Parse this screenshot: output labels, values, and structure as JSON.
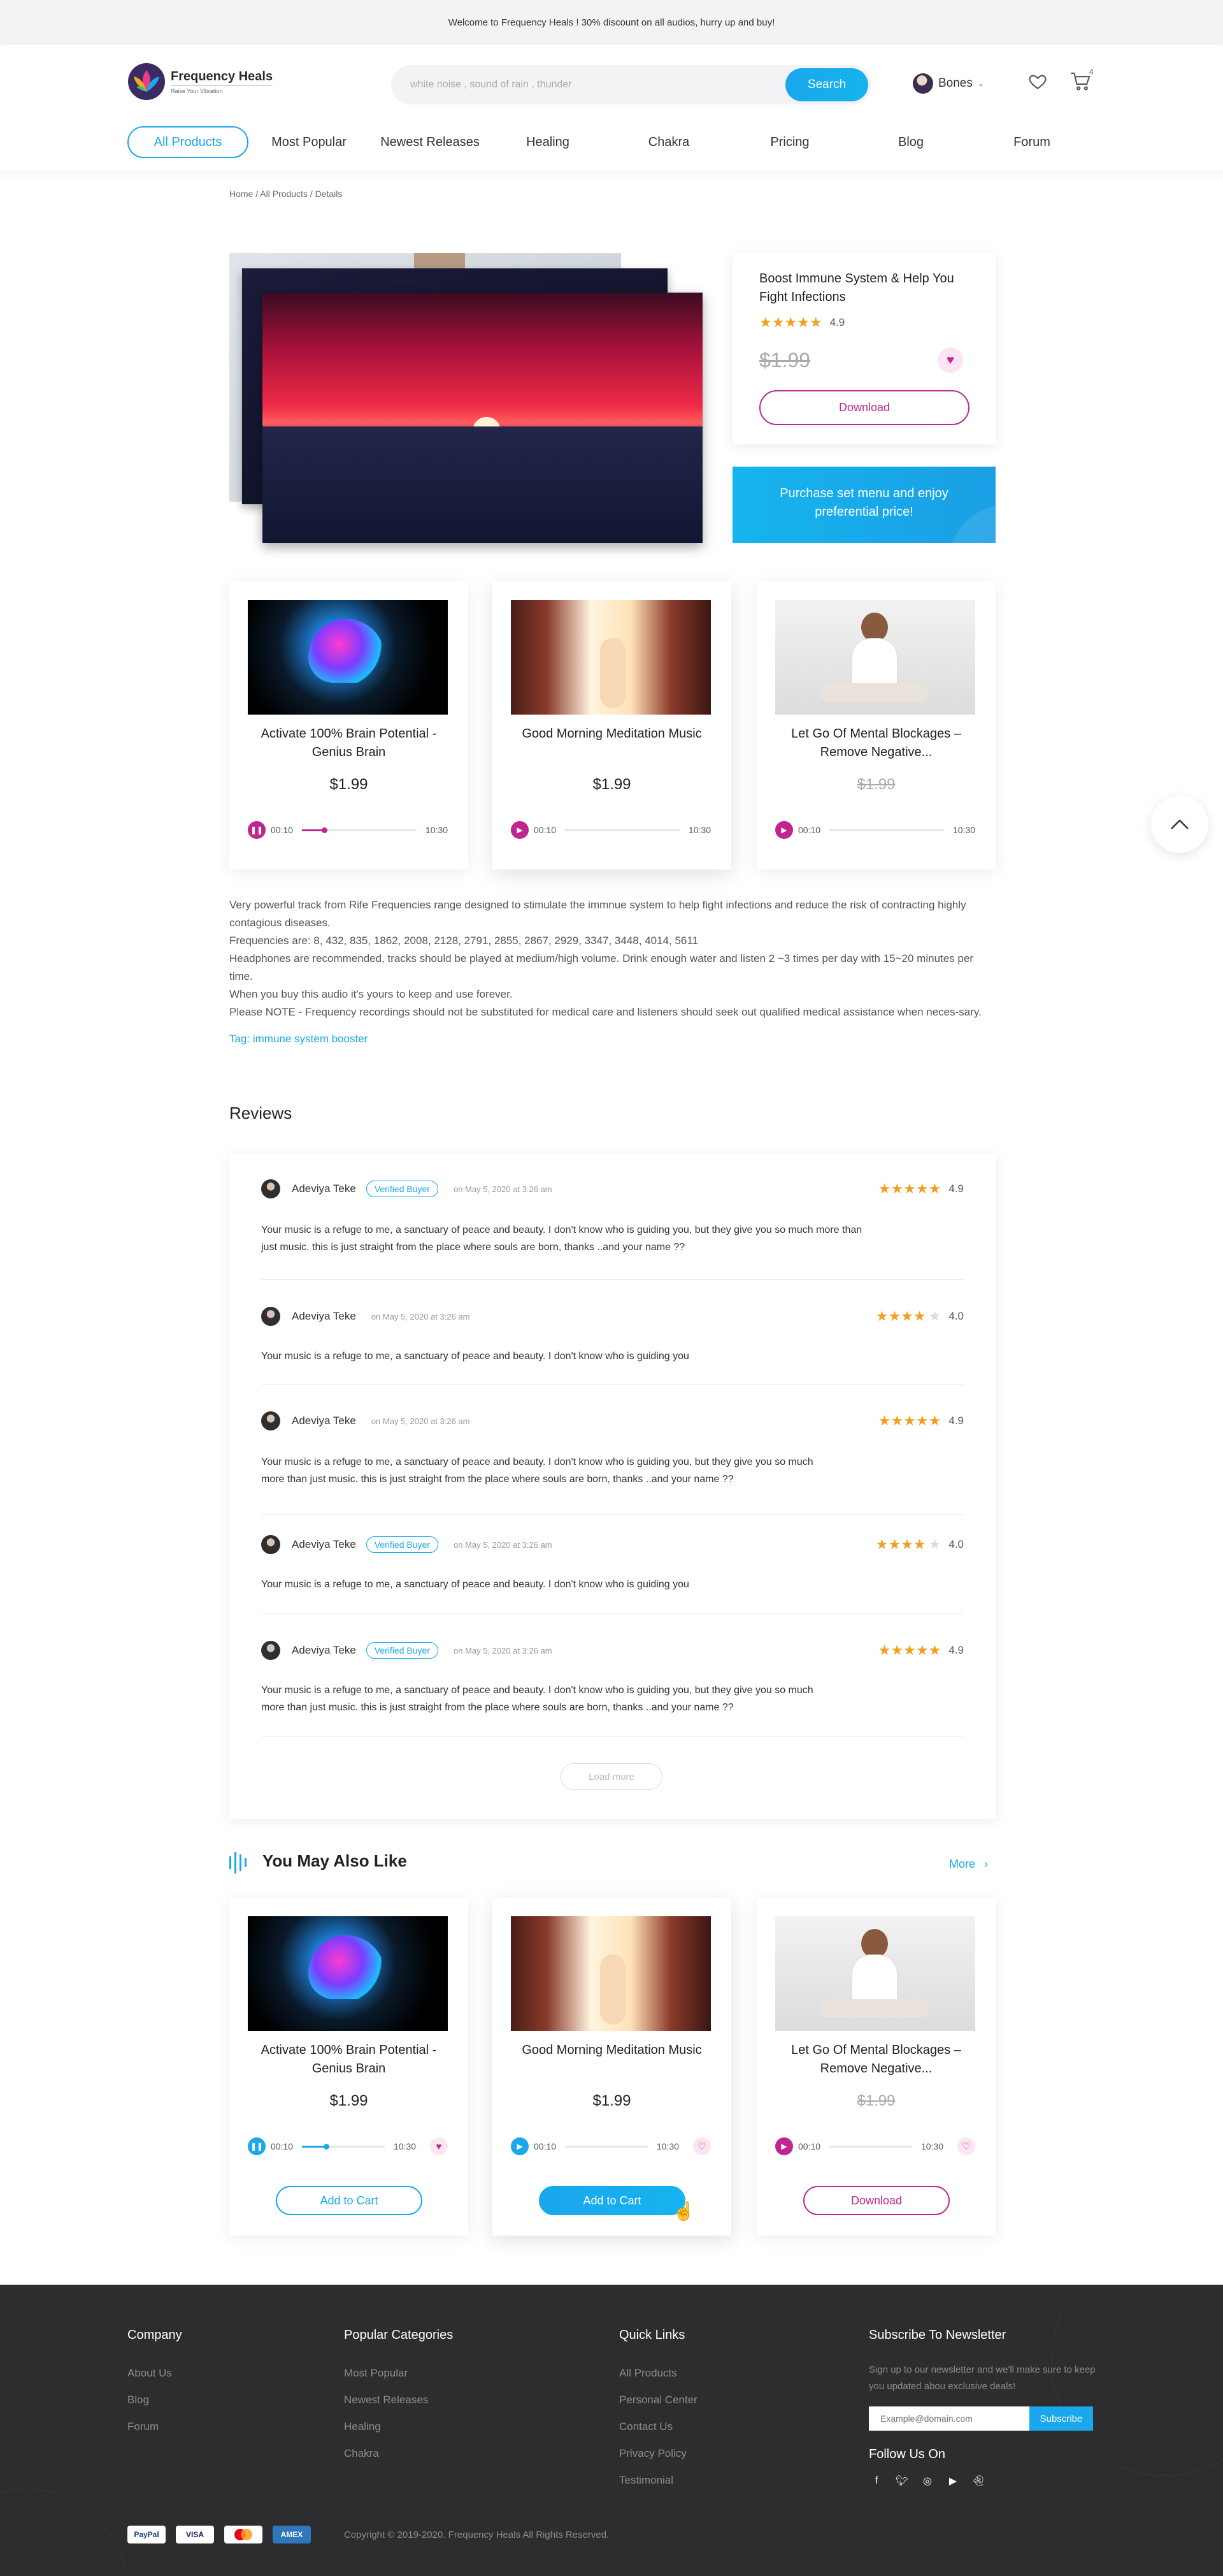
{
  "announcement": "Welcome to Frequency Heals ! 30% discount on all audios, hurry up and buy!",
  "brand": {
    "name": "Frequency Heals",
    "tagline": "Raise Your Vibration"
  },
  "search": {
    "placeholder": "white noise , sound of rain , thunder",
    "button": "Search"
  },
  "user": {
    "name": "Bones"
  },
  "cart_count": "4",
  "nav": [
    "All Products",
    "Most Popular",
    "Newest Releases",
    "Healing",
    "Chakra",
    "Pricing",
    "Blog",
    "Forum"
  ],
  "breadcrumb": "Home / All Products / Details",
  "product": {
    "title": "Boost Immune System & Help You Fight Infections",
    "rating": "4.9",
    "price": "$1.99",
    "download": "Download",
    "promo": "Purchase set menu and enjoy preferential price!"
  },
  "tracks": [
    {
      "title": "Activate 100% Brain Potential - Genius Brain",
      "price": "$1.99",
      "current": "00:10",
      "duration": "10:30",
      "progress": 0.2,
      "playing": true
    },
    {
      "title": "Good Morning Meditation Music",
      "price": "$1.99",
      "current": "00:10",
      "duration": "10:30",
      "progress": 0,
      "playing": false
    },
    {
      "title": "Let Go Of Mental Blockages – Remove Negative...",
      "price": "$1.99",
      "current": "00:10",
      "duration": "10:30",
      "progress": 0,
      "playing": false
    }
  ],
  "description": [
    "Very powerful track from Rife Frequencies range designed to stimulate the immnue system to help fight infections and reduce the risk of contracting highly contagious diseases.",
    "Frequencies are: 8, 432, 835, 1862, 2008, 2128, 2791, 2855, 2867, 2929, 3347, 3448, 4014, 5611",
    "Headphones are recommended, tracks should be played at medium/high volume. Drink enough water and listen 2 ~3 times per day with 15~20 minutes per time.",
    "When you buy this audio it's yours to keep and use forever.",
    "Please NOTE - Frequency recordings should not be substituted for medical care and listeners should seek out qualified medical assistance when neces-sary."
  ],
  "tag": "Tag: immune system booster",
  "reviews_title": "Reviews",
  "reviews": [
    {
      "name": "Adeviya Teke",
      "verified": "Verified Buyer",
      "date": "on May 5, 2020 at 3:26 am",
      "rating": "4.9",
      "text": "Your music is a refuge to me, a sanctuary of peace and beauty. I don't know who is guiding you, but they give you so much more than just music. this is just straight from the place where souls are born, thanks ..and your name ??"
    },
    {
      "name": "Adeviya Teke",
      "verified": "",
      "date": "on May 5, 2020 at 3:26 am",
      "rating": "4.0",
      "text": "Your music is a refuge to me, a sanctuary of peace and beauty. I don't know who is guiding you"
    },
    {
      "name": "Adeviya Teke",
      "verified": "",
      "date": "on May 5, 2020 at 3:26 am",
      "rating": "4.9",
      "text": "Your music is a refuge to me, a sanctuary of peace and beauty. I don't know who is guiding you, but they give you so much more than just music. this is just straight from the place where souls are born, thanks ..and your name ??"
    },
    {
      "name": "Adeviya Teke",
      "verified": "Verified Buyer",
      "date": "on May 5, 2020 at 3:26 am",
      "rating": "4.0",
      "text": "Your music is a refuge to me, a sanctuary of peace and beauty. I don't know who is guiding you"
    },
    {
      "name": "Adeviya Teke",
      "verified": "Verified Buyer",
      "date": "on May 5, 2020 at 3:26 am",
      "rating": "4.9",
      "text": "Your music is a refuge to me, a sanctuary of peace and beauty. I don't know who is guiding you, but they give you so much more than just music. this is just straight from the place where souls are born, thanks ..and your name ??"
    }
  ],
  "load_more": "Load more",
  "also_like": {
    "title": "You May Also Like",
    "more": "More",
    "items": [
      {
        "title": "Activate 100% Brain Potential - Genius Brain",
        "price": "$1.99",
        "current": "00:10",
        "duration": "10:30",
        "progress": 0.3,
        "button": "Add to Cart"
      },
      {
        "title": "Good Morning Meditation Music",
        "price": "$1.99",
        "current": "00:10",
        "duration": "10:30",
        "progress": 0,
        "button": "Add to Cart"
      },
      {
        "title": "Let Go Of Mental Blockages – Remove Negative...",
        "price": "$1.99",
        "current": "00:10",
        "duration": "10:30",
        "progress": 0,
        "button": "Download"
      }
    ]
  },
  "footer": {
    "company": {
      "title": "Company",
      "links": [
        "About Us",
        "Blog",
        "Forum"
      ]
    },
    "categories": {
      "title": "Popular Categories",
      "links": [
        "Most Popular",
        "Newest Releases",
        "Healing",
        "Chakra"
      ]
    },
    "quick": {
      "title": "Quick Links",
      "links": [
        "All Products",
        "Personal Center",
        "Contact Us",
        "Privacy Policy",
        "Testimonial"
      ]
    },
    "newsletter": {
      "title": "Subscribe To Newsletter",
      "text": "Sign up to our newsletter and we'll make sure to keep you updated abou exclusive deals!",
      "placeholder": "Example@domain.com",
      "button": "Subscribe"
    },
    "follow": "Follow Us On",
    "payments": [
      "PayPal",
      "VISA",
      "MC",
      "AMEX"
    ],
    "copyright": "Copyright © 2019-2020. Frequency Heals All Rights Reserved."
  },
  "colors": {
    "accent": "#1aa7ec",
    "magenta": "#c0268e",
    "star": "#f0a020",
    "footer_bg": "#2d2d2f"
  }
}
